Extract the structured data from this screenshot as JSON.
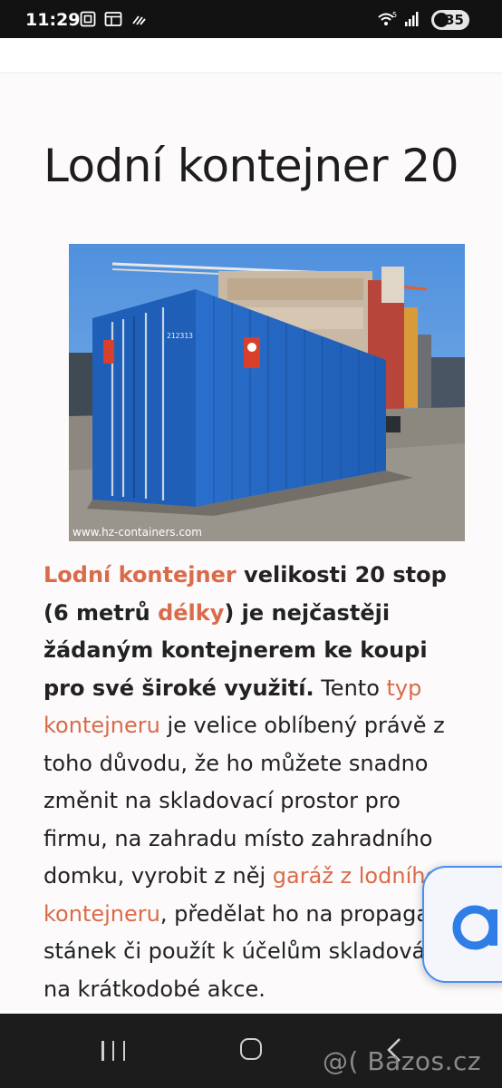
{
  "status_bar": {
    "time": "11:29",
    "battery": "35",
    "icons_left": [
      "screenshot-icon",
      "gallery-icon",
      "data-saver-icon"
    ],
    "icons_right": [
      "wifi-icon",
      "signal-icon"
    ],
    "wifi_label": "5"
  },
  "article": {
    "title": "Lodní kontejner 20",
    "image": {
      "watermark": "www.hz-containers.com",
      "colors": {
        "sky": "#5f9fe0",
        "container": "#2266c2",
        "ground": "#8c8880"
      }
    },
    "paragraph": {
      "link_lodni": "Lodní kontejner",
      "bold_1": " velikosti 20 stop (6 metrů ",
      "link_delky": "délky",
      "bold_2": ") je nejčastěji žádaným kontejnerem ke koupi pro své široké využití.",
      "text_1": " Tento ",
      "link_typ": "typ kontejneru",
      "text_2": " je velice oblíbený právě z toho důvodu, že ho můžete snadno změnit na skladovací prostor pro firmu, na zahradu místo zahradního domku, vyrobit z něj ",
      "link_garaz": "garáž z lodního kontejneru",
      "text_3": ", předělat ho na propagační stánek či použít k účelům skladování na krátkodobé akce."
    }
  },
  "overlay": {
    "ai_badge_label": "ai"
  },
  "navigation_bar": {
    "watermark": "@( Bazos.cz",
    "buttons": [
      "recent-apps",
      "home",
      "back"
    ]
  },
  "colors": {
    "link": "#d96b4a",
    "text": "#222222",
    "status_bar_bg": "#121212",
    "nav_bar_bg": "#1c1c1c"
  }
}
